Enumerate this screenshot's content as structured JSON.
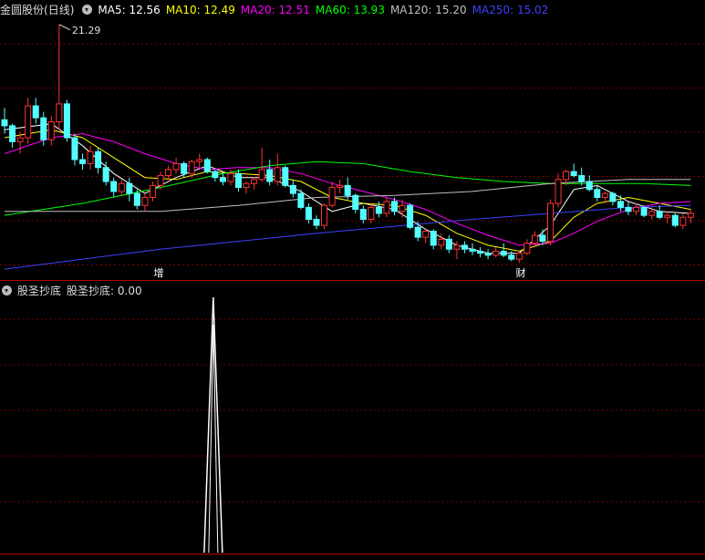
{
  "main_panel": {
    "stock_name": "金圆股份",
    "period": "(日线)",
    "ma_items": [
      {
        "label": "MA5: 12.56",
        "color": "#ffffff"
      },
      {
        "label": "MA10: 12.49",
        "color": "#ffff00"
      },
      {
        "label": "MA20: 12.51",
        "color": "#ff00ff"
      },
      {
        "label": "MA60: 13.93",
        "color": "#00ff00"
      },
      {
        "label": "MA120: 15.20",
        "color": "#c0c0c0"
      },
      {
        "label": "MA250: 15.02",
        "color": "#4040ff"
      }
    ],
    "high_marker": "21.29",
    "event_markers": [
      "增",
      "财"
    ]
  },
  "sub_panel": {
    "indicator_name": "股圣抄底",
    "value_label": "股圣抄底: 0.00"
  },
  "colors": {
    "background": "#000000",
    "grid": "#7a0000",
    "up": "#ff3232",
    "down": "#54ffff",
    "text": "#dcdcdc",
    "signal": "#ffffff"
  },
  "chart_data": [
    {
      "type": "candlestick",
      "title": "金圆股份(日线)",
      "ylim": [
        8.5,
        21.6
      ],
      "grid": true,
      "candles": [
        [
          16.5,
          17.1,
          15.8,
          16.2
        ],
        [
          16.2,
          16.3,
          15.1,
          15.4
        ],
        [
          15.4,
          15.9,
          14.8,
          15.6
        ],
        [
          15.6,
          17.6,
          15.3,
          17.2
        ],
        [
          17.2,
          17.6,
          16.3,
          16.6
        ],
        [
          16.6,
          16.9,
          15.2,
          15.5
        ],
        [
          15.5,
          16.7,
          15.2,
          16.4
        ],
        [
          16.4,
          21.29,
          16.0,
          17.3
        ],
        [
          17.3,
          17.5,
          15.4,
          15.6
        ],
        [
          15.6,
          15.8,
          14.2,
          14.5
        ],
        [
          14.5,
          14.8,
          14.0,
          14.3
        ],
        [
          14.3,
          15.2,
          14.0,
          14.9
        ],
        [
          14.9,
          15.1,
          13.8,
          14.1
        ],
        [
          14.1,
          14.4,
          13.2,
          13.4
        ],
        [
          13.4,
          13.6,
          12.6,
          12.9
        ],
        [
          12.9,
          13.5,
          12.7,
          13.3
        ],
        [
          13.3,
          13.6,
          12.4,
          12.8
        ],
        [
          12.8,
          13.0,
          12.0,
          12.2
        ],
        [
          12.2,
          12.8,
          11.9,
          12.6
        ],
        [
          12.6,
          13.4,
          12.4,
          13.2
        ],
        [
          13.2,
          13.9,
          13.0,
          13.7
        ],
        [
          13.7,
          14.2,
          13.5,
          14.0
        ],
        [
          14.0,
          14.6,
          13.8,
          14.3
        ],
        [
          14.3,
          14.4,
          13.6,
          13.8
        ],
        [
          13.8,
          14.5,
          13.6,
          14.4
        ],
        [
          14.4,
          14.8,
          14.1,
          14.5
        ],
        [
          14.5,
          14.6,
          13.8,
          13.9
        ],
        [
          13.9,
          14.0,
          13.4,
          13.6
        ],
        [
          13.6,
          13.8,
          13.2,
          13.4
        ],
        [
          13.4,
          14.0,
          13.2,
          13.8
        ],
        [
          13.8,
          14.0,
          12.9,
          13.1
        ],
        [
          13.1,
          13.4,
          12.8,
          13.3
        ],
        [
          13.3,
          13.6,
          13.0,
          13.5
        ],
        [
          13.5,
          15.1,
          13.4,
          14.0
        ],
        [
          14.0,
          14.5,
          13.2,
          13.4
        ],
        [
          13.4,
          14.8,
          13.2,
          14.1
        ],
        [
          14.1,
          14.2,
          13.1,
          13.2
        ],
        [
          13.2,
          13.5,
          12.6,
          12.8
        ],
        [
          12.8,
          13.0,
          12.0,
          12.1
        ],
        [
          12.1,
          12.3,
          11.3,
          11.5
        ],
        [
          11.5,
          11.7,
          11.0,
          11.2
        ],
        [
          11.2,
          12.3,
          11.0,
          12.2
        ],
        [
          12.2,
          13.4,
          12.1,
          13.1
        ],
        [
          13.1,
          13.5,
          12.8,
          13.2
        ],
        [
          13.2,
          13.6,
          12.5,
          12.7
        ],
        [
          12.7,
          12.8,
          11.8,
          12.0
        ],
        [
          12.0,
          12.2,
          11.3,
          11.5
        ],
        [
          11.5,
          12.3,
          11.3,
          12.1
        ],
        [
          12.1,
          12.4,
          11.6,
          11.8
        ],
        [
          11.8,
          12.6,
          11.6,
          12.4
        ],
        [
          12.4,
          12.6,
          11.7,
          11.9
        ],
        [
          11.9,
          12.5,
          11.6,
          12.2
        ],
        [
          12.2,
          12.3,
          11.0,
          11.1
        ],
        [
          11.1,
          11.4,
          10.4,
          10.6
        ],
        [
          10.6,
          11.0,
          10.3,
          10.9
        ],
        [
          10.9,
          11.0,
          10.0,
          10.2
        ],
        [
          10.2,
          10.8,
          10.0,
          10.5
        ],
        [
          10.5,
          10.7,
          9.8,
          10.0
        ],
        [
          10.0,
          10.4,
          9.5,
          10.2
        ],
        [
          10.2,
          10.4,
          9.8,
          10.0
        ],
        [
          10.0,
          10.3,
          9.7,
          9.9
        ],
        [
          9.9,
          10.1,
          9.6,
          9.8
        ],
        [
          9.8,
          10.0,
          9.5,
          9.7
        ],
        [
          9.7,
          10.1,
          9.6,
          9.9
        ],
        [
          9.9,
          10.3,
          9.6,
          9.7
        ],
        [
          9.7,
          9.9,
          9.4,
          9.5
        ],
        [
          9.5,
          9.9,
          9.3,
          9.8
        ],
        [
          9.8,
          10.5,
          9.7,
          10.3
        ],
        [
          10.3,
          10.9,
          10.1,
          10.7
        ],
        [
          10.7,
          11.0,
          10.2,
          10.4
        ],
        [
          10.4,
          12.5,
          10.2,
          12.3
        ],
        [
          12.3,
          13.8,
          12.1,
          13.5
        ],
        [
          13.5,
          14.0,
          13.2,
          13.9
        ],
        [
          13.9,
          14.3,
          13.6,
          13.7
        ],
        [
          13.7,
          14.1,
          13.2,
          13.4
        ],
        [
          13.4,
          13.7,
          12.9,
          13.0
        ],
        [
          13.0,
          13.2,
          12.4,
          12.6
        ],
        [
          12.6,
          12.9,
          12.3,
          12.8
        ],
        [
          12.8,
          12.9,
          12.2,
          12.4
        ],
        [
          12.4,
          12.7,
          11.9,
          12.1
        ],
        [
          12.1,
          12.4,
          11.7,
          11.9
        ],
        [
          11.9,
          12.3,
          11.7,
          12.1
        ],
        [
          12.1,
          12.2,
          11.6,
          11.7
        ],
        [
          11.7,
          12.1,
          11.5,
          11.9
        ],
        [
          11.9,
          12.2,
          11.5,
          11.6
        ],
        [
          11.6,
          11.9,
          11.3,
          11.7
        ],
        [
          11.7,
          11.8,
          11.1,
          11.2
        ],
        [
          11.2,
          11.8,
          11.0,
          11.6
        ],
        [
          11.6,
          12.0,
          11.3,
          11.8
        ]
      ],
      "ma_lines": {
        "ma5": [
          [
            0,
            16.0
          ],
          [
            6,
            16.3
          ],
          [
            10,
            15.2
          ],
          [
            14,
            13.8
          ],
          [
            18,
            12.8
          ],
          [
            22,
            13.6
          ],
          [
            26,
            14.2
          ],
          [
            30,
            13.6
          ],
          [
            34,
            13.6
          ],
          [
            38,
            12.9
          ],
          [
            42,
            11.9
          ],
          [
            46,
            12.3
          ],
          [
            50,
            12.0
          ],
          [
            54,
            11.0
          ],
          [
            58,
            10.2
          ],
          [
            62,
            9.8
          ],
          [
            66,
            9.8
          ],
          [
            70,
            11.2
          ],
          [
            73,
            13.0
          ],
          [
            76,
            13.2
          ],
          [
            80,
            12.4
          ],
          [
            84,
            11.9
          ],
          [
            88,
            11.8
          ]
        ],
        "ma10": [
          [
            0,
            15.6
          ],
          [
            6,
            16.0
          ],
          [
            10,
            15.6
          ],
          [
            14,
            14.6
          ],
          [
            18,
            13.6
          ],
          [
            22,
            13.5
          ],
          [
            26,
            13.9
          ],
          [
            30,
            13.8
          ],
          [
            34,
            13.7
          ],
          [
            38,
            13.4
          ],
          [
            42,
            12.6
          ],
          [
            46,
            12.3
          ],
          [
            50,
            12.2
          ],
          [
            54,
            11.7
          ],
          [
            58,
            10.8
          ],
          [
            62,
            10.2
          ],
          [
            66,
            9.9
          ],
          [
            70,
            10.4
          ],
          [
            73,
            11.6
          ],
          [
            76,
            12.3
          ],
          [
            80,
            12.6
          ],
          [
            84,
            12.3
          ],
          [
            88,
            12.0
          ]
        ],
        "ma20": [
          [
            0,
            14.8
          ],
          [
            6,
            15.6
          ],
          [
            10,
            15.8
          ],
          [
            14,
            15.4
          ],
          [
            18,
            14.8
          ],
          [
            22,
            14.3
          ],
          [
            26,
            14.0
          ],
          [
            30,
            14.1
          ],
          [
            34,
            14.1
          ],
          [
            38,
            13.8
          ],
          [
            42,
            13.3
          ],
          [
            46,
            12.9
          ],
          [
            50,
            12.5
          ],
          [
            54,
            12.0
          ],
          [
            58,
            11.3
          ],
          [
            62,
            10.7
          ],
          [
            66,
            10.2
          ],
          [
            70,
            10.3
          ],
          [
            73,
            10.8
          ],
          [
            76,
            11.4
          ],
          [
            80,
            12.0
          ],
          [
            84,
            12.3
          ],
          [
            88,
            12.4
          ]
        ],
        "ma60": [
          [
            0,
            11.7
          ],
          [
            10,
            12.3
          ],
          [
            20,
            13.1
          ],
          [
            28,
            13.8
          ],
          [
            34,
            14.2
          ],
          [
            40,
            14.4
          ],
          [
            46,
            14.3
          ],
          [
            52,
            13.9
          ],
          [
            58,
            13.6
          ],
          [
            64,
            13.4
          ],
          [
            70,
            13.3
          ],
          [
            76,
            13.3
          ],
          [
            82,
            13.3
          ],
          [
            88,
            13.2
          ]
        ],
        "ma120": [
          [
            0,
            11.9
          ],
          [
            20,
            11.9
          ],
          [
            30,
            12.2
          ],
          [
            40,
            12.6
          ],
          [
            50,
            12.7
          ],
          [
            60,
            12.9
          ],
          [
            70,
            13.3
          ],
          [
            80,
            13.5
          ],
          [
            88,
            13.5
          ]
        ],
        "ma250": [
          [
            0,
            9.0
          ],
          [
            20,
            10.0
          ],
          [
            40,
            10.8
          ],
          [
            60,
            11.5
          ],
          [
            70,
            11.8
          ],
          [
            80,
            12.1
          ],
          [
            88,
            12.2
          ]
        ]
      }
    },
    {
      "type": "line",
      "title": "股圣抄底",
      "ylim": [
        0,
        1
      ],
      "spike_index": 27,
      "series": [
        {
          "name": "股圣抄底",
          "values": [
            0.0,
            1.0,
            0.0
          ]
        }
      ]
    }
  ]
}
